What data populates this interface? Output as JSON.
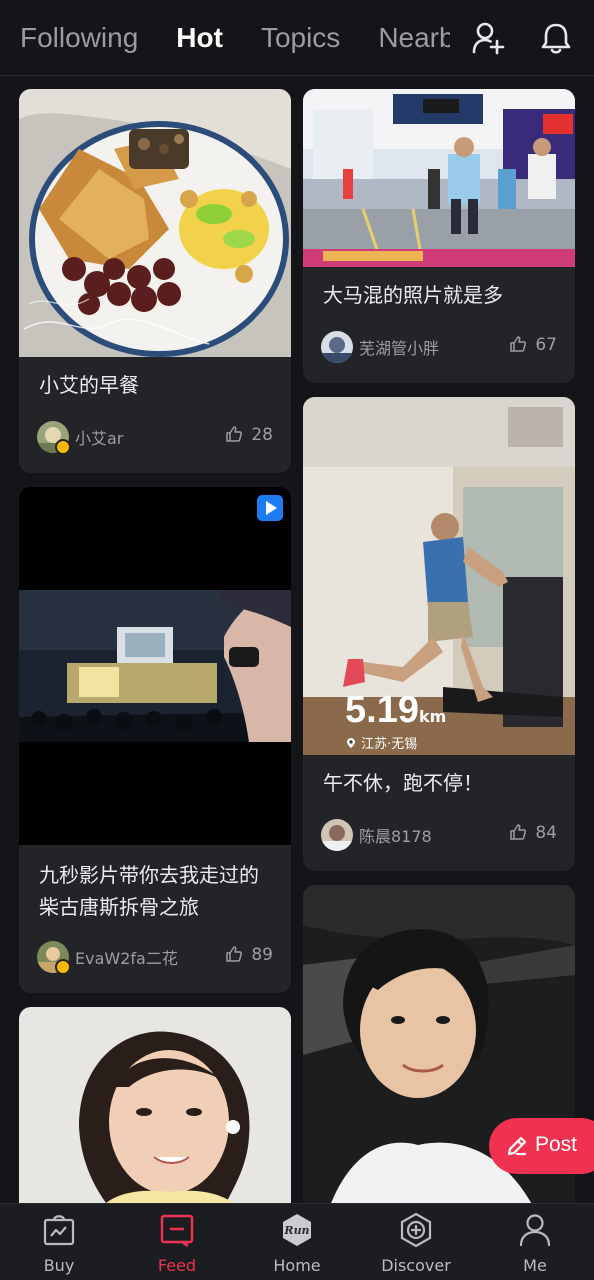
{
  "tabs": [
    "Following",
    "Hot",
    "Topics",
    "Nearby"
  ],
  "active_tab": "Hot",
  "colors": {
    "accent": "#f0314f",
    "indicator_dot": "#3c8cf5",
    "background": "#141518",
    "card": "#232428"
  },
  "icons": {
    "add_user": "add-user-icon",
    "notifications": "bell-icon",
    "like": "thumbs-up-icon",
    "video": "play-icon"
  },
  "cards": [
    {
      "title": "小艾的早餐",
      "author": "小艾ar",
      "likes": "28"
    },
    {
      "title": "九秒影片带你去我走过的柴古唐斯拆骨之旅",
      "author": "EvaW2fa二花",
      "likes": "89"
    },
    {
      "title": "大马混的照片就是多",
      "author": "芜湖管小胖",
      "likes": "67"
    },
    {
      "title": "午不休，跑不停！",
      "author": "陈晨8178",
      "likes": "84",
      "overlay_distance": "5.19",
      "overlay_unit": "km",
      "overlay_location": "江苏·无锡"
    }
  ],
  "post_button": "Post",
  "bottom_nav": [
    {
      "label": "Buy",
      "icon": "shopping-bag-icon"
    },
    {
      "label": "Feed",
      "icon": "feed-icon",
      "active": true
    },
    {
      "label": "Home",
      "icon": "run-logo-icon"
    },
    {
      "label": "Discover",
      "icon": "discover-plus-icon"
    },
    {
      "label": "Me",
      "icon": "profile-icon"
    }
  ],
  "home_logo_text": "Run"
}
